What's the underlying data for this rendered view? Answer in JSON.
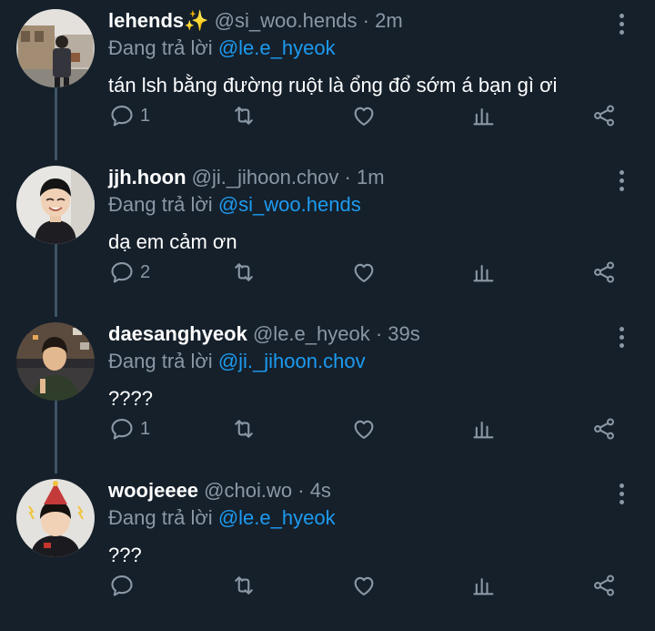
{
  "tweets": [
    {
      "name": "lehends",
      "badge": "✨",
      "handle": "@si_woo.hends",
      "separator": "·",
      "time": "2m",
      "reply_prefix": "Đang trả lời",
      "reply_to": "@le.e_hyeok",
      "text": "tán lsh bằng đường ruột là ổng đổ sớm á bạn gì ơi",
      "reply_count": "1",
      "avatar_icon": "street-photo-avatar"
    },
    {
      "name": "jjh.hoon",
      "badge": "",
      "handle": "@ji._jihoon.chov",
      "separator": "·",
      "time": "1m",
      "reply_prefix": "Đang trả lời",
      "reply_to": "@si_woo.hends",
      "text": "dạ em cảm ơn",
      "reply_count": "2",
      "avatar_icon": "smiling-person-avatar"
    },
    {
      "name": "daesanghyeok",
      "badge": "",
      "handle": "@le.e_hyeok",
      "separator": "·",
      "time": "39s",
      "reply_prefix": "Đang trả lời",
      "reply_to": "@ji._jihoon.chov",
      "text": "????",
      "reply_count": "1",
      "avatar_icon": "city-night-avatar"
    },
    {
      "name": "woojeeee",
      "badge": "",
      "handle": "@choi.wo",
      "separator": "·",
      "time": "4s",
      "reply_prefix": "Đang trả lời",
      "reply_to": "@le.e_hyeok",
      "text": "???",
      "reply_count": "",
      "avatar_icon": "party-hat-avatar"
    }
  ],
  "colors": {
    "background": "#15202b",
    "text": "#ffffff",
    "muted": "#8b98a5",
    "accent": "#1d9bf0",
    "thread_line": "#3d5466"
  },
  "icons": {
    "reply": "reply-icon",
    "retweet": "retweet-icon",
    "like": "heart-icon",
    "stats": "stats-icon",
    "share": "share-icon",
    "more": "more-options-icon"
  }
}
